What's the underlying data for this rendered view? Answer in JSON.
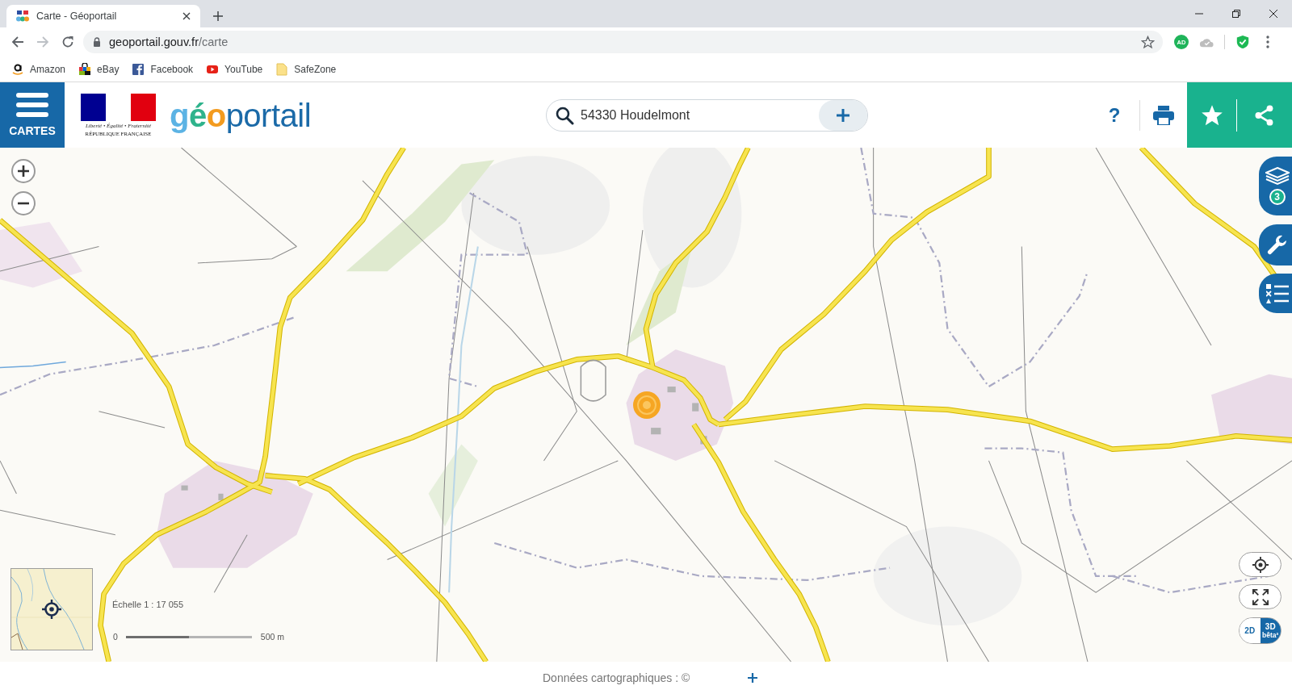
{
  "browser": {
    "tab": {
      "title": "Carte - Géoportail",
      "selected": true
    },
    "nav": [
      {
        "kind": "back",
        "disabled": false
      },
      {
        "kind": "forward",
        "disabled": true
      },
      {
        "kind": "reload",
        "disabled": false
      }
    ],
    "url": {
      "host": "geoportail.gouv.fr",
      "path": "/carte"
    },
    "extensions": [
      {
        "kind": "badge",
        "label": "AD"
      },
      {
        "kind": "cloud"
      },
      {
        "kind": "shield"
      }
    ],
    "bookmarks": [
      {
        "label": "Amazon"
      },
      {
        "label": "eBay"
      },
      {
        "label": "Facebook"
      },
      {
        "label": "YouTube"
      },
      {
        "label": "SafeZone"
      }
    ]
  },
  "header": {
    "menu": {
      "label": "CARTES"
    },
    "republic_logo": {
      "motto": "Liberté • Égalité • Fraternité",
      "name": "RÉPUBLIQUE FRANÇAISE"
    },
    "brand": {
      "parts": [
        {
          "text": "g",
          "color": "#5cb3e4",
          "bold": true
        },
        {
          "text": "é",
          "color": "#2fb38c",
          "bold": true
        },
        {
          "text": "o",
          "color": "#f39b1f",
          "bold": true
        },
        {
          "text": "portail",
          "color": "#1b6aa8",
          "bold": false
        }
      ]
    },
    "search": {
      "value": "54330 Houdelmont"
    },
    "help": {
      "label": "?"
    }
  },
  "map": {
    "layers": {
      "count": "3"
    },
    "toggle": {
      "options": [
        {
          "label": "2D",
          "selected": false
        },
        {
          "label": "3D",
          "note": "bêta²",
          "selected": true
        }
      ]
    },
    "scale": {
      "label": "Échelle 1 : 17 055",
      "start": "0",
      "end": "500 m"
    }
  },
  "footer": {
    "attribution": "Données cartographiques : ©"
  }
}
